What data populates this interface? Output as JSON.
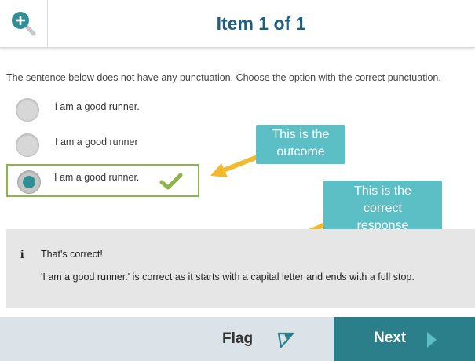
{
  "header": {
    "zoom_icon": "zoom-in-icon",
    "title": "Item 1 of 1"
  },
  "question": {
    "prompt": "The sentence below does not have any punctuation. Choose the option with the correct punctuation.",
    "options": [
      {
        "label": "i am a good runner.",
        "selected": false
      },
      {
        "label": "I am a good runner",
        "selected": false
      },
      {
        "label": "I am a good runner.",
        "selected": true,
        "marked_correct": true
      }
    ]
  },
  "callouts": [
    {
      "text_lines": [
        "This is the",
        "outcome"
      ]
    },
    {
      "text_lines": [
        "This is the",
        "correct",
        "response"
      ]
    }
  ],
  "feedback": {
    "icon": "info-icon",
    "title": "That's correct!",
    "body": "'I am a good runner.' is correct as it starts with a capital letter and ends with a full stop."
  },
  "footer": {
    "flag_label": "Flag",
    "flag_icon": "flag-icon",
    "next_label": "Next",
    "next_icon": "chevron-right-icon"
  },
  "colors": {
    "title": "#1f5f84",
    "accent_teal": "#2e8f94",
    "callout": "#5cbfc5",
    "arrow": "#f2b92a",
    "correct_border": "#8cb54a",
    "next_bg": "#2b7f8a",
    "footer_bg": "#dbe2e8",
    "feedback_bg": "#e6e6e6"
  }
}
